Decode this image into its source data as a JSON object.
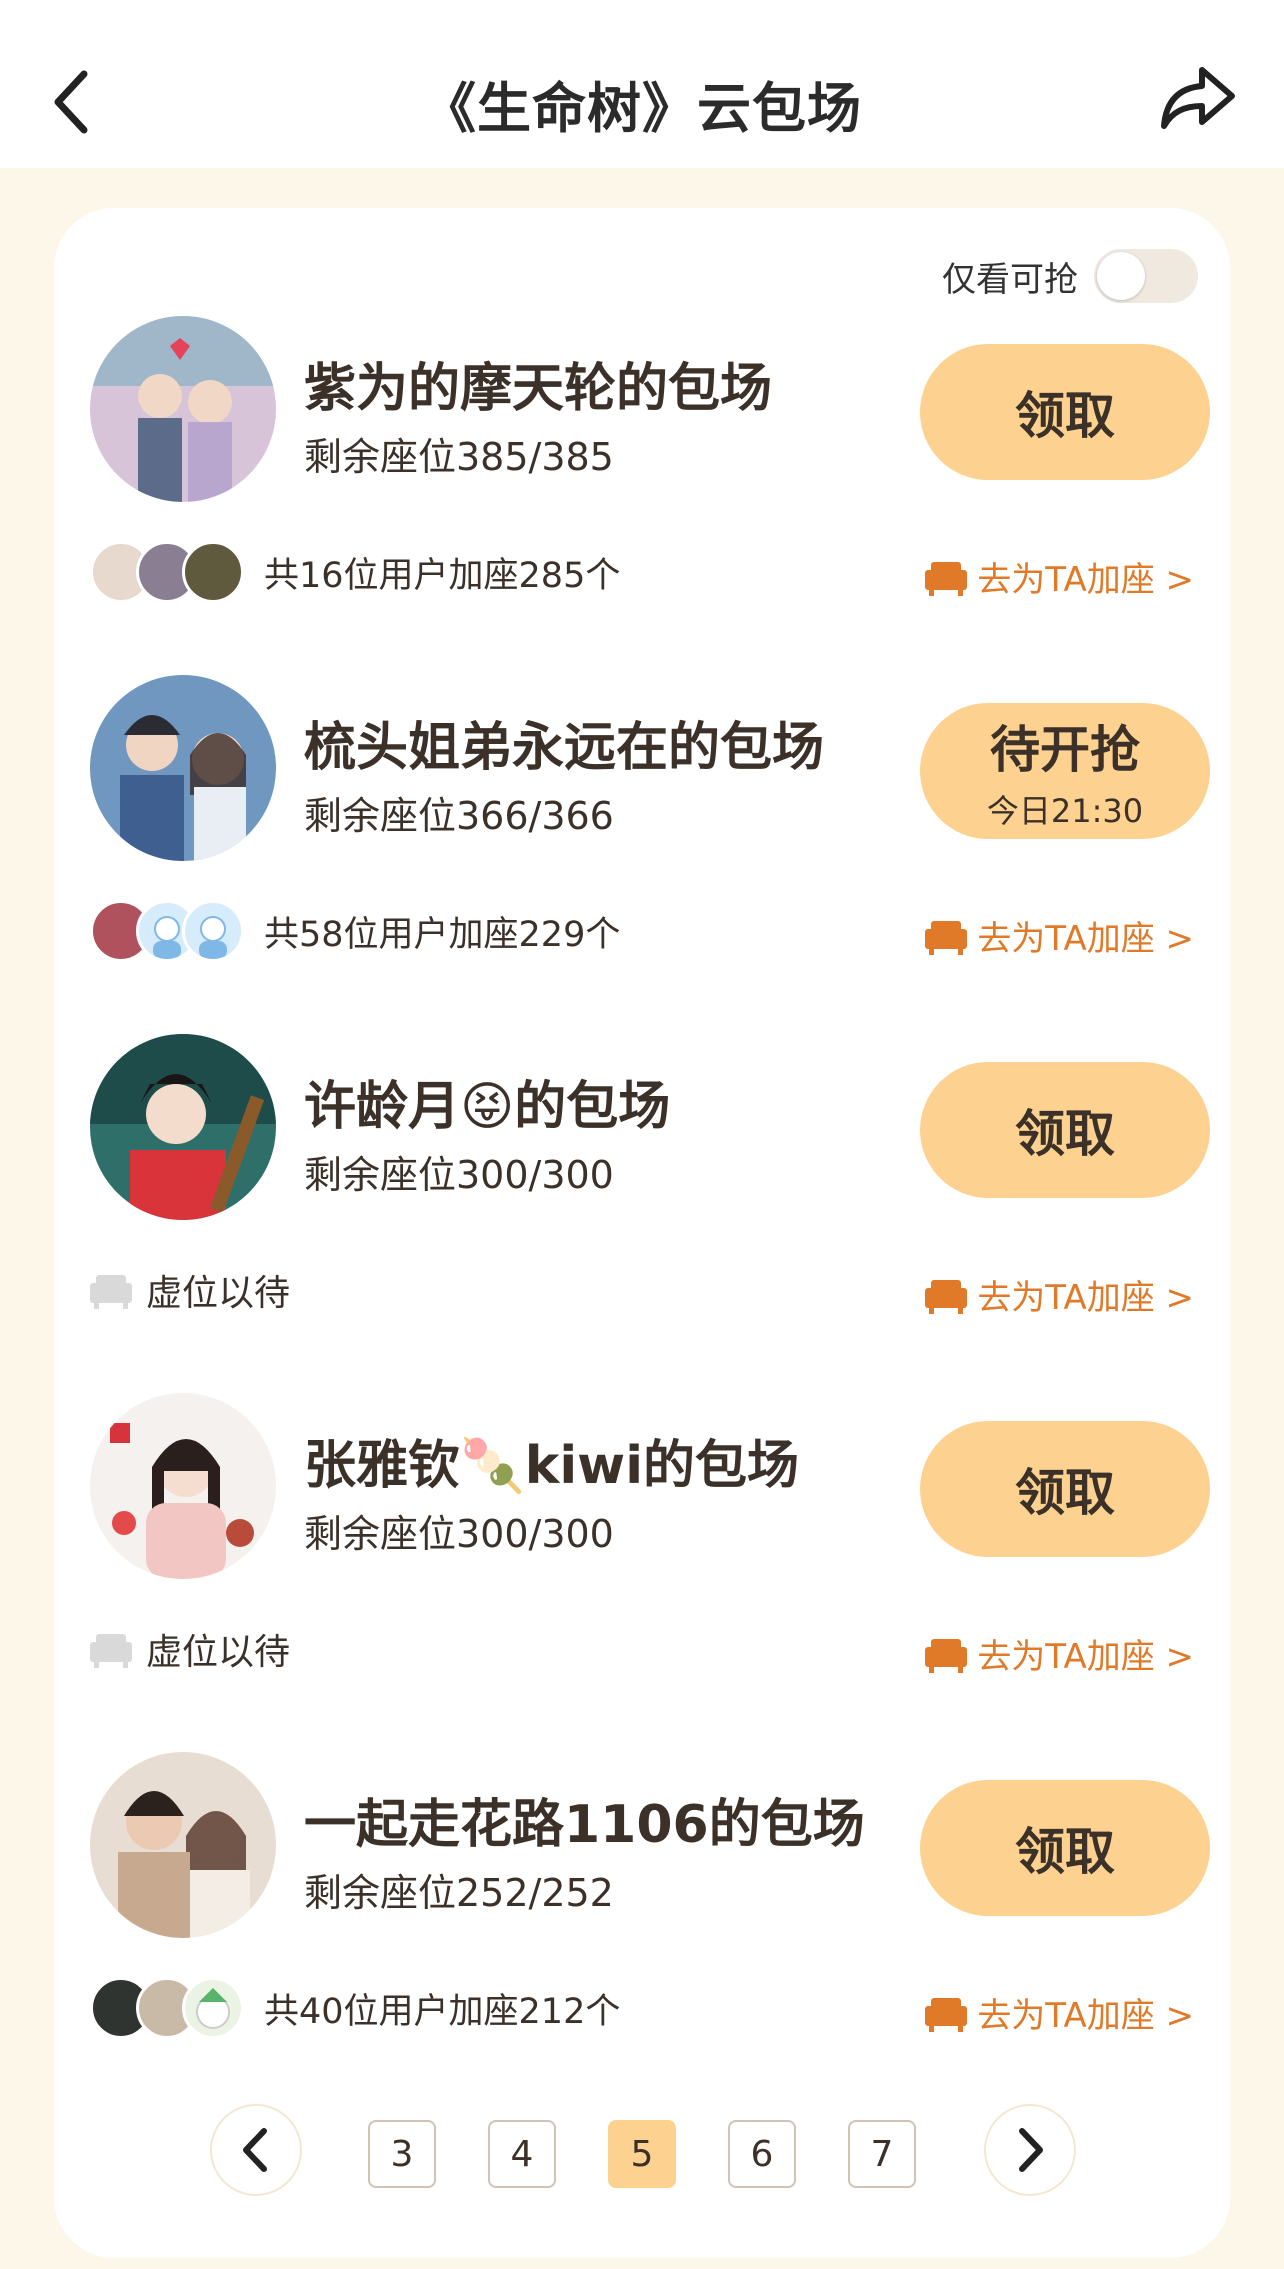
{
  "header": {
    "title": "《生命树》云包场",
    "back_icon": "chevron-left-icon",
    "share_icon": "share-arrow-icon"
  },
  "filter": {
    "label": "仅看可抢",
    "enabled": false
  },
  "colors": {
    "accent": "#fdd18f",
    "link": "#e07a28",
    "bg": "#fdf7ea"
  },
  "items": [
    {
      "name": "紫为的摩天轮的包场",
      "seats": "剩余座位385/385",
      "action_main": "领取",
      "action_sub": "",
      "meta_text": "共16位用户加座285个",
      "add_link": "去为TA加座 >"
    },
    {
      "name": "梳头姐弟永远在的包场",
      "seats": "剩余座位366/366",
      "action_main": "待开抢",
      "action_sub": "今日21:30",
      "meta_text": "共58位用户加座229个",
      "add_link": "去为TA加座 >"
    },
    {
      "name": "许龄月😝的包场",
      "seats": "剩余座位300/300",
      "action_main": "领取",
      "action_sub": "",
      "meta_text": "虚位以待",
      "add_link": "去为TA加座 >"
    },
    {
      "name": "张雅钦🍡kiwi的包场",
      "seats": "剩余座位300/300",
      "action_main": "领取",
      "action_sub": "",
      "meta_text": "虚位以待",
      "add_link": "去为TA加座 >"
    },
    {
      "name": "一起走花路1106的包场",
      "seats": "剩余座位252/252",
      "action_main": "领取",
      "action_sub": "",
      "meta_text": "共40位用户加座212个",
      "add_link": "去为TA加座 >"
    }
  ],
  "pagination": {
    "pages": [
      "3",
      "4",
      "5",
      "6",
      "7"
    ],
    "current": "5"
  }
}
